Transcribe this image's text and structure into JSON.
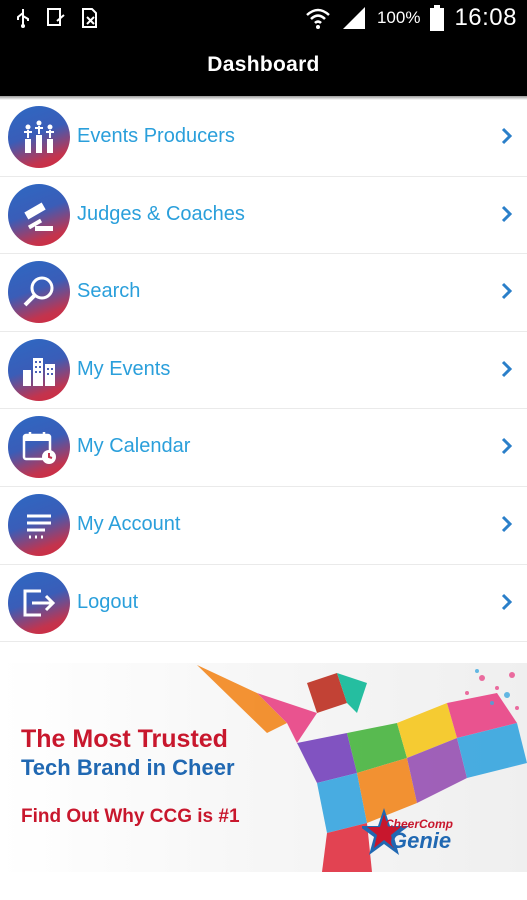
{
  "status_bar": {
    "icons": [
      "usb-icon",
      "device-icon",
      "sim-icon",
      "wifi-icon",
      "signal-icon",
      "battery-icon"
    ],
    "battery": "100%",
    "time": "16:08"
  },
  "app_bar": {
    "title": "Dashboard"
  },
  "menu": {
    "items": [
      {
        "label": "Events Producers",
        "icon": "event-producers-icon"
      },
      {
        "label": "Judges & Coaches",
        "icon": "gavel-icon"
      },
      {
        "label": "Search",
        "icon": "magnifier-icon"
      },
      {
        "label": "My Events",
        "icon": "buildings-icon"
      },
      {
        "label": "My Calendar",
        "icon": "calendar-icon"
      },
      {
        "label": "My Account",
        "icon": "account-lines-icon"
      },
      {
        "label": "Logout",
        "icon": "logout-icon"
      }
    ]
  },
  "banner": {
    "line1": "The Most Trusted",
    "line2": "Tech Brand in Cheer",
    "line3": "Find Out Why CCG is #1",
    "logo_text_top": "CheerComp",
    "logo_text_bottom": "Genie"
  },
  "colors": {
    "accent_text": "#2a9fdb",
    "banner_red": "#c8172d",
    "banner_blue": "#2068b2"
  }
}
